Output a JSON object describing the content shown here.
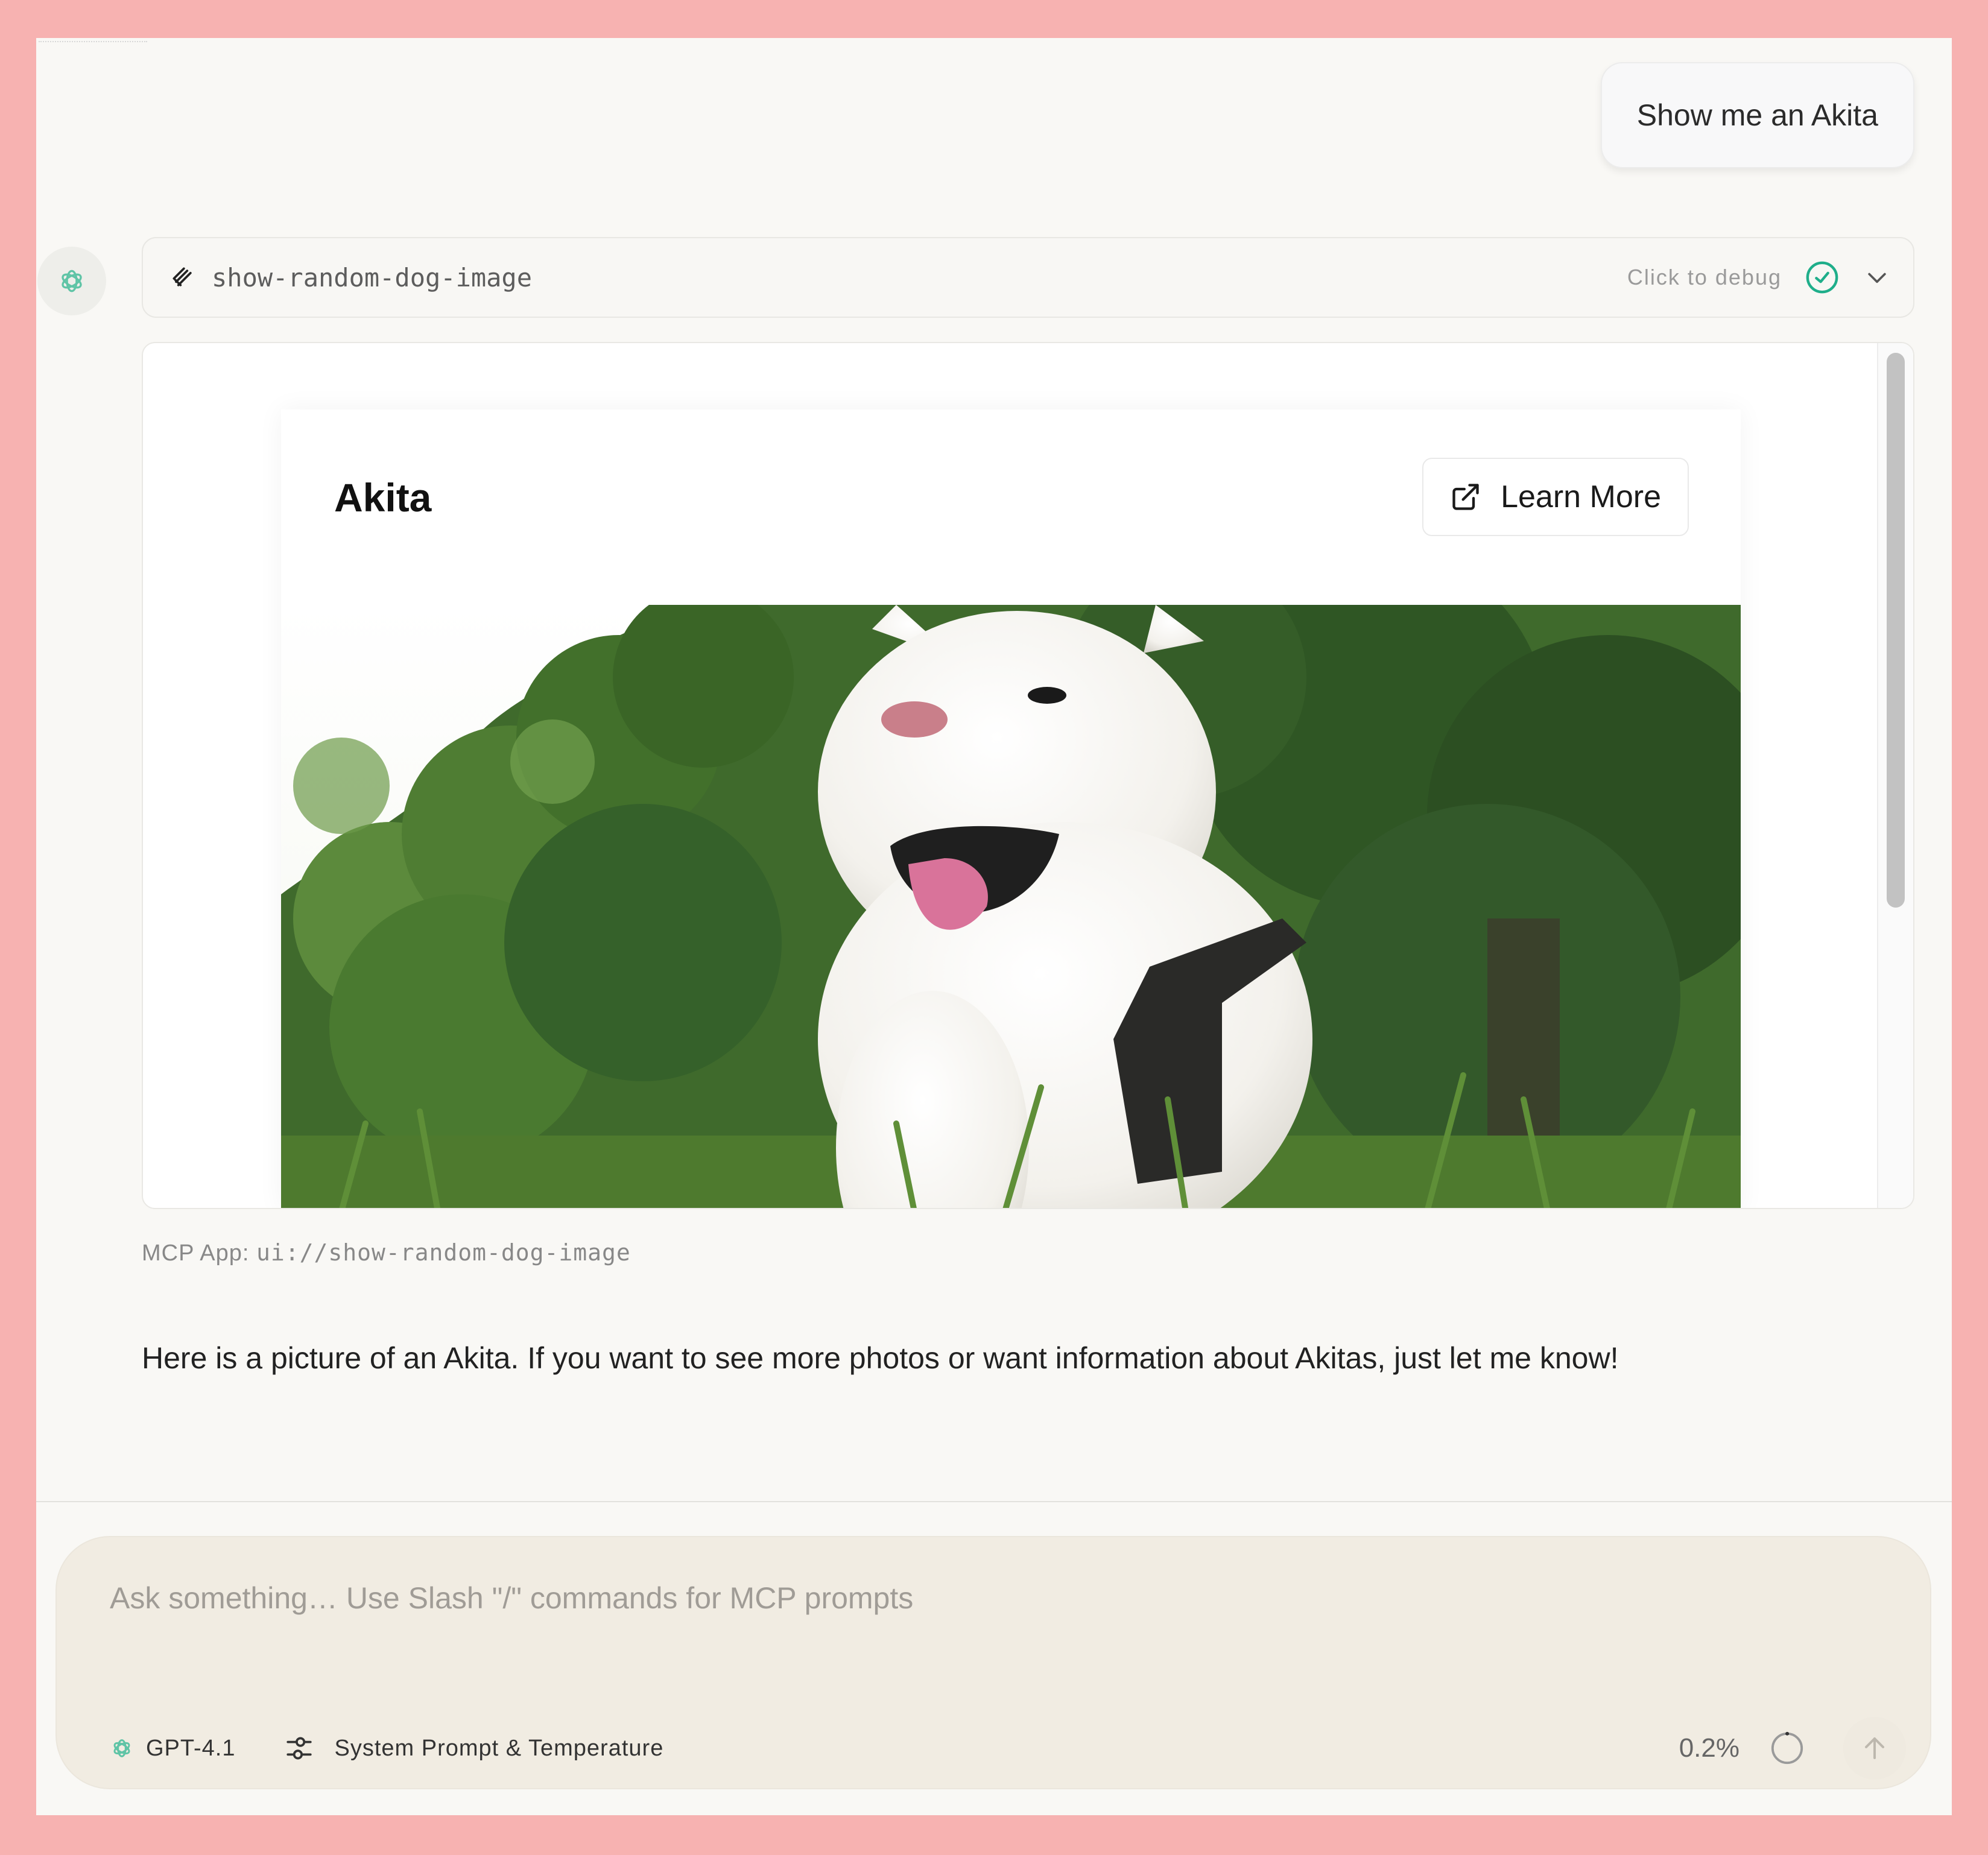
{
  "user_message": "Show me an Akita",
  "tool_call": {
    "name": "show-random-dog-image",
    "debug_label": "Click to debug"
  },
  "widget": {
    "title": "Akita",
    "learn_more_label": "Learn More"
  },
  "caption": {
    "prefix": "MCP App: ",
    "uri": "ui://show-random-dog-image"
  },
  "assistant_reply": "Here is a picture of an Akita. If you want to see more photos or want information about Akitas, just let me know!",
  "composer": {
    "placeholder": "Ask something… Use Slash \"/\" commands for MCP prompts",
    "model_label": "GPT-4.1",
    "settings_label": "System Prompt & Temperature",
    "context_usage": "0.2%"
  },
  "icons": {
    "assistant_avatar": "openai-logo-icon",
    "tool": "tool-icon",
    "status": "check-circle-icon",
    "expand": "chevron-down-icon",
    "learn_more": "external-link-icon",
    "model": "openai-logo-icon",
    "settings": "sliders-icon",
    "context": "progress-ring-icon",
    "send": "arrow-up-icon"
  },
  "colors": {
    "page_border": "#f7b2b1",
    "background": "#f9f8f5",
    "composer": "#f1ece2",
    "success": "#1fae8a"
  }
}
